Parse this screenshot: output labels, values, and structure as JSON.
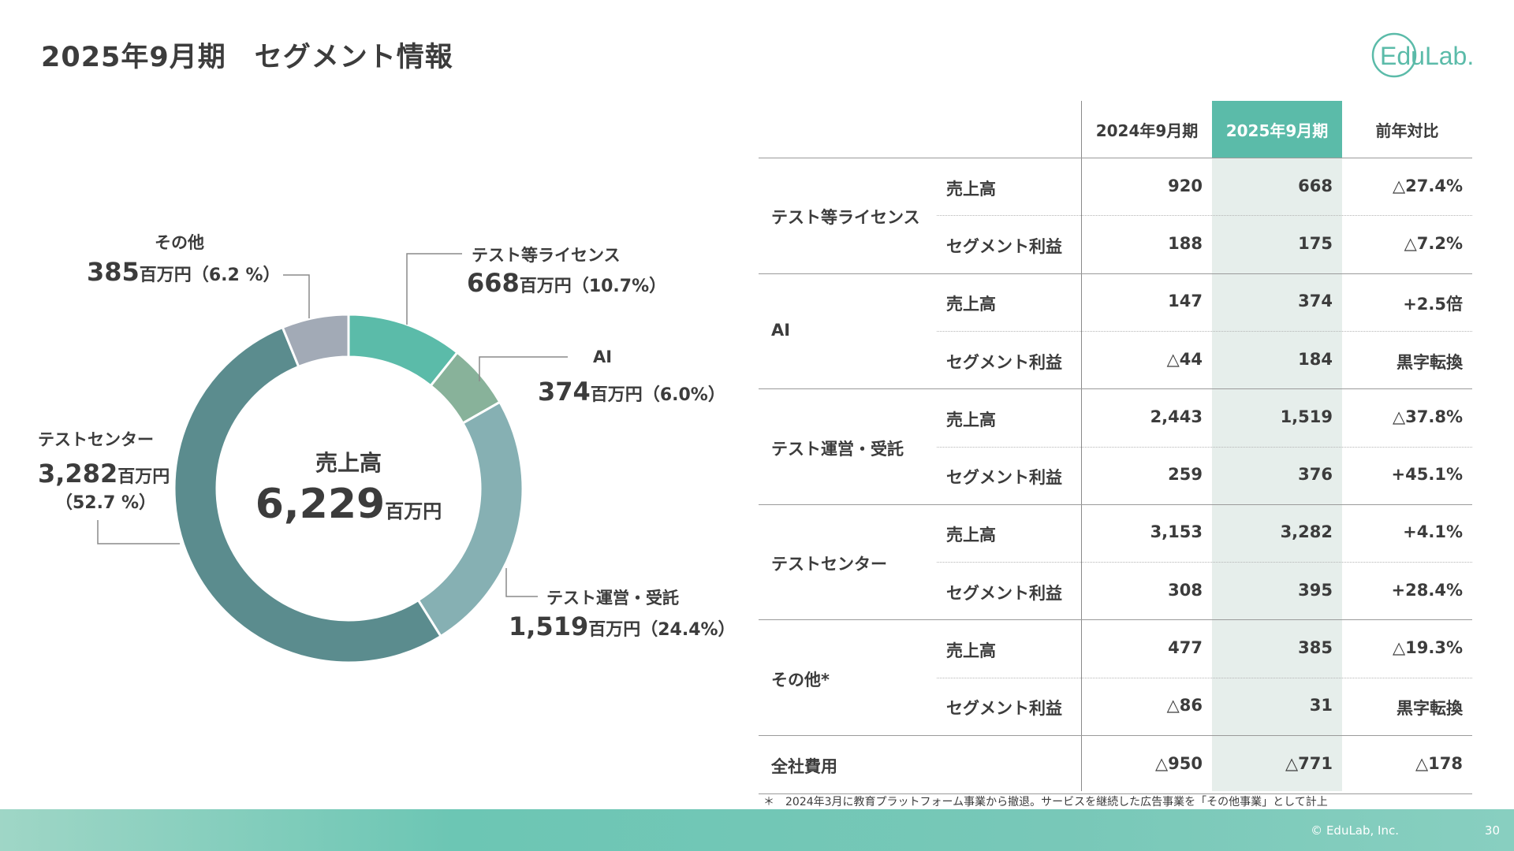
{
  "title": "2025年9月期　セグメント情報",
  "logo_text": "EduLab.",
  "colors": {
    "license": "#5bbba9",
    "ai": "#88b29a",
    "ops": "#86b0b3",
    "center": "#5b8c8e",
    "other": "#a2aab6",
    "highlight_col": "#5bbba9"
  },
  "chart_data": {
    "type": "pie",
    "title": "",
    "center_label": "売上高",
    "center_value": "6,229",
    "center_unit": "百万円",
    "slices": [
      {
        "name": "テスト等ライセンス",
        "value": 668,
        "value_label": "668",
        "unit": "百万円",
        "pct_label": "（10.7%）",
        "color_key": "license"
      },
      {
        "name": "AI",
        "value": 374,
        "value_label": "374",
        "unit": "百万円",
        "pct_label": "（6.0%）",
        "color_key": "ai"
      },
      {
        "name": "テスト運営・受託",
        "value": 1519,
        "value_label": "1,519",
        "unit": "百万円",
        "pct_label": "（24.4%）",
        "color_key": "ops"
      },
      {
        "name": "テストセンター",
        "value": 3282,
        "value_label": "3,282",
        "unit": "百万円",
        "pct_label": "（52.7 %）",
        "color_key": "center"
      },
      {
        "name": "その他",
        "value": 385,
        "value_label": "385",
        "unit": "百万円",
        "pct_label": "（6.2 %）",
        "color_key": "other"
      }
    ]
  },
  "table": {
    "headers": [
      "2024年9月期",
      "2025年9月期",
      "前年対比"
    ],
    "segments": [
      {
        "name": "テスト等ライセンス",
        "rows": [
          {
            "metric": "売上高",
            "fy2024": "920",
            "fy2025": "668",
            "yoy": "△27.4%"
          },
          {
            "metric": "セグメント利益",
            "fy2024": "188",
            "fy2025": "175",
            "yoy": "△7.2%"
          }
        ]
      },
      {
        "name": "AI",
        "rows": [
          {
            "metric": "売上高",
            "fy2024": "147",
            "fy2025": "374",
            "yoy": "+2.5倍"
          },
          {
            "metric": "セグメント利益",
            "fy2024": "△44",
            "fy2025": "184",
            "yoy": "黒字転換"
          }
        ]
      },
      {
        "name": "テスト運営・受託",
        "rows": [
          {
            "metric": "売上高",
            "fy2024": "2,443",
            "fy2025": "1,519",
            "yoy": "△37.8%"
          },
          {
            "metric": "セグメント利益",
            "fy2024": "259",
            "fy2025": "376",
            "yoy": "+45.1%"
          }
        ]
      },
      {
        "name": "テストセンター",
        "rows": [
          {
            "metric": "売上高",
            "fy2024": "3,153",
            "fy2025": "3,282",
            "yoy": "+4.1%"
          },
          {
            "metric": "セグメント利益",
            "fy2024": "308",
            "fy2025": "395",
            "yoy": "+28.4%"
          }
        ]
      },
      {
        "name": "その他*",
        "rows": [
          {
            "metric": "売上高",
            "fy2024": "477",
            "fy2025": "385",
            "yoy": "△19.3%"
          },
          {
            "metric": "セグメント利益",
            "fy2024": "△86",
            "fy2025": "31",
            "yoy": "黒字転換"
          }
        ]
      }
    ],
    "total": {
      "name": "全社費用",
      "fy2024": "△950",
      "fy2025": "△771",
      "yoy": "△178"
    }
  },
  "footnote": "＊　2024年3月に教育プラットフォーム事業から撤退。サービスを継続した広告事業を「その他事業」として計上",
  "footer": {
    "copyright": "© EduLab, Inc.",
    "page": "30"
  }
}
